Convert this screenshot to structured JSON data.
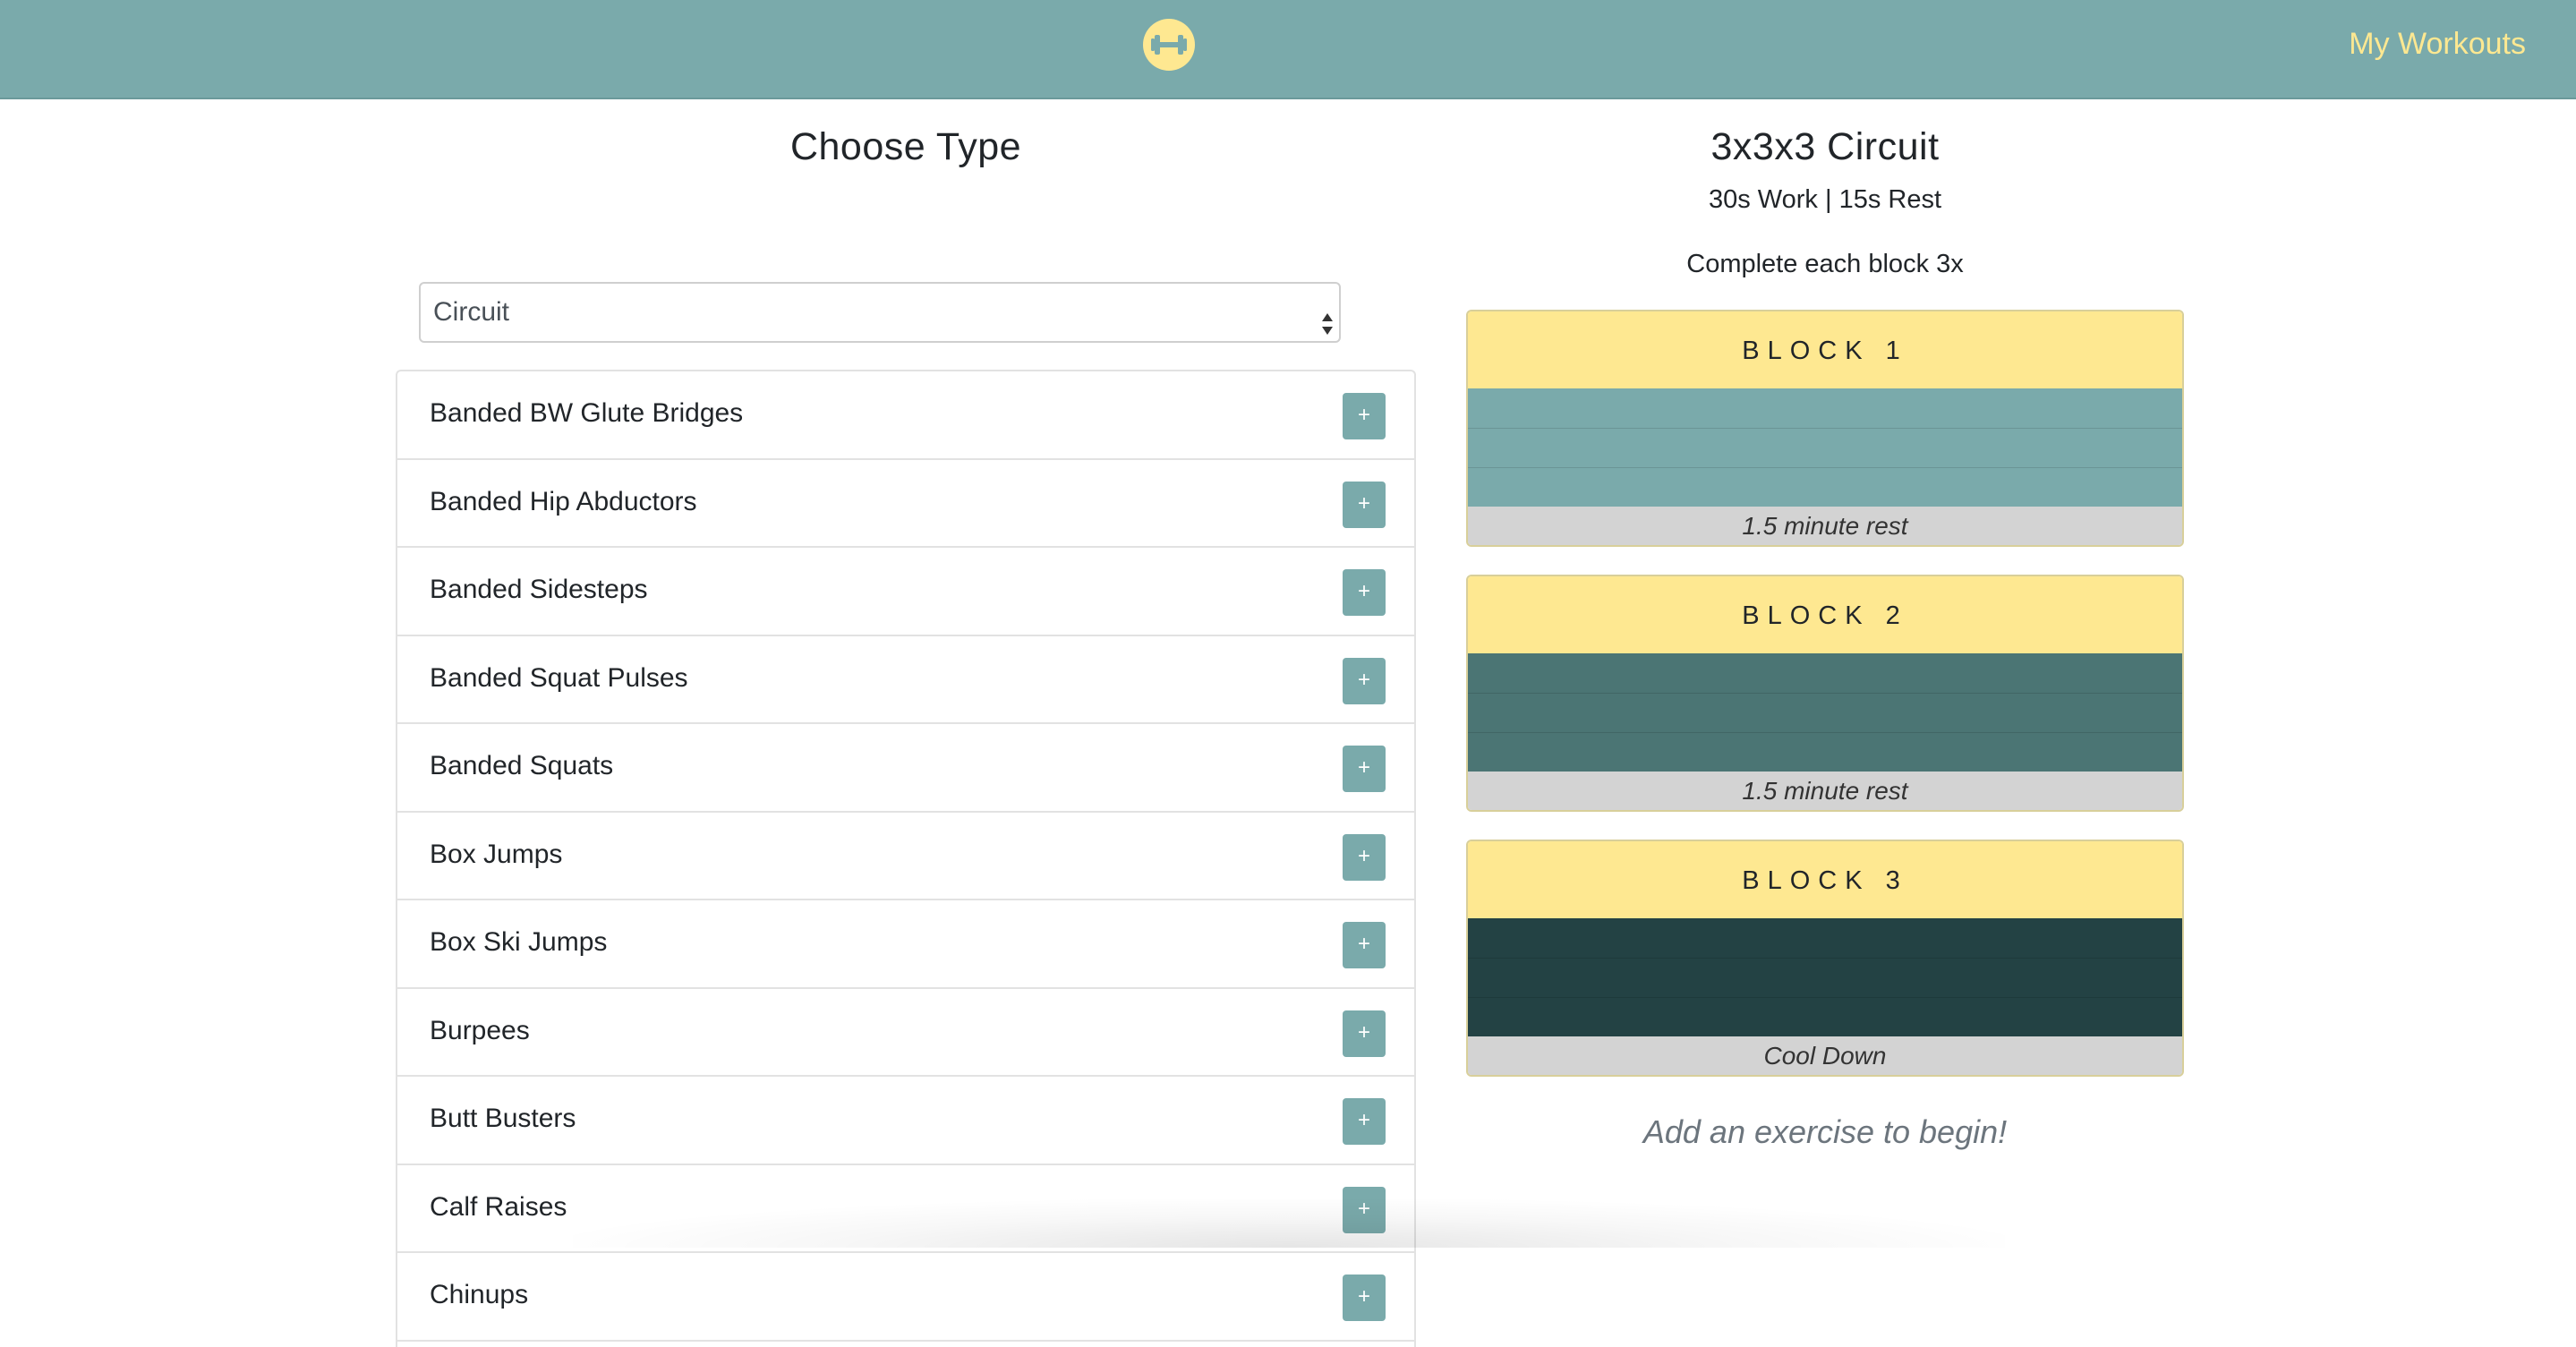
{
  "header": {
    "logo_icon": "dumbbell-icon",
    "nav_link": "My Workouts",
    "colors": {
      "bar": "#7aaaab",
      "accent": "#fee891"
    }
  },
  "type_picker": {
    "title": "Choose Type",
    "selected": "Circuit"
  },
  "exercises": [
    {
      "name": "Banded BW Glute Bridges",
      "add_label": "+"
    },
    {
      "name": "Banded Hip Abductors",
      "add_label": "+"
    },
    {
      "name": "Banded Sidesteps",
      "add_label": "+"
    },
    {
      "name": "Banded Squat Pulses",
      "add_label": "+"
    },
    {
      "name": "Banded Squats",
      "add_label": "+"
    },
    {
      "name": "Box Jumps",
      "add_label": "+"
    },
    {
      "name": "Box Ski Jumps",
      "add_label": "+"
    },
    {
      "name": "Burpees",
      "add_label": "+"
    },
    {
      "name": "Butt Busters",
      "add_label": "+"
    },
    {
      "name": "Calf Raises",
      "add_label": "+"
    },
    {
      "name": "Chinups",
      "add_label": "+"
    }
  ],
  "workout": {
    "title": "3x3x3 Circuit",
    "timing": "30s Work | 15s Rest",
    "instruction": "Complete each block 3x",
    "blocks": [
      {
        "label": "BLOCK 1",
        "slot_color": "#7aaaab",
        "footer": "1.5 minute rest"
      },
      {
        "label": "BLOCK 2",
        "slot_color": "#4b7574",
        "footer": "1.5 minute rest"
      },
      {
        "label": "BLOCK 3",
        "slot_color": "#234244",
        "footer": "Cool Down"
      }
    ],
    "empty_message": "Add an exercise to begin!"
  }
}
